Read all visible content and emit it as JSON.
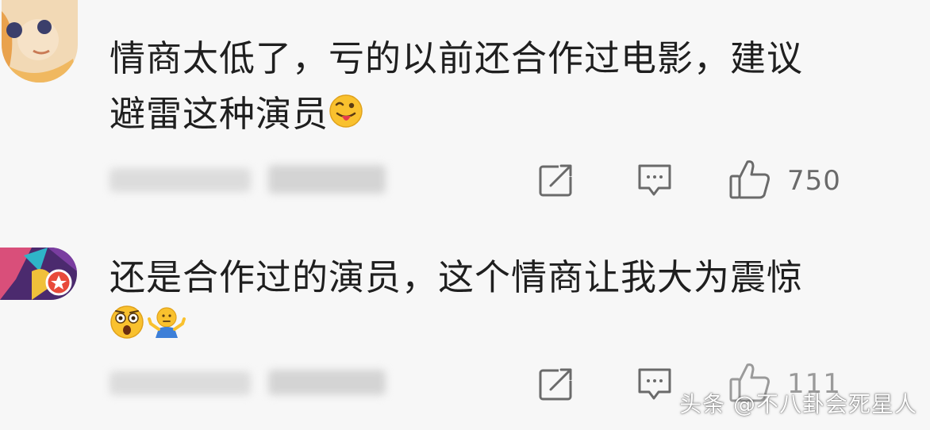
{
  "comments": [
    {
      "text_line1": "情商太低了，亏的以前还合作过电影，建议",
      "text_line2": "避雷这种演员",
      "emojis": [
        "tongue-out-emoji"
      ],
      "likes": "750"
    },
    {
      "text_line1": "还是合作过的演员，这个情商让我大为震惊",
      "emojis": [
        "shocked-emoji",
        "shrug-emoji"
      ],
      "likes": "111"
    }
  ],
  "watermark": "头条 @不八卦会死星人",
  "colors": {
    "background": "#f7f7f7",
    "text": "#1f1f1f",
    "icon": "#6a6a6a"
  }
}
